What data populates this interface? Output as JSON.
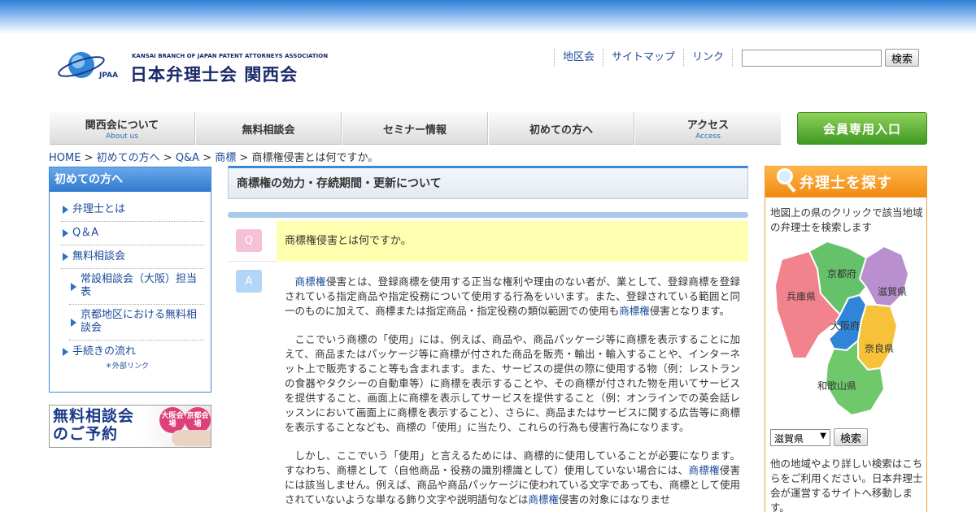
{
  "header": {
    "logo_sub": "KANSAI BRANCH OF JAPAN PATENT ATTORNEYS ASSOCIATION",
    "logo_mark": "JPAA",
    "logo_name": "日本弁理士会 関西会",
    "links": [
      "地区会",
      "サイトマップ",
      "リンク"
    ],
    "search_button": "検索",
    "search_value": ""
  },
  "gnav": [
    {
      "label": "関西会について",
      "sub": "About us"
    },
    {
      "label": "無料相談会",
      "sub": ""
    },
    {
      "label": "セミナー情報",
      "sub": ""
    },
    {
      "label": "初めての方へ",
      "sub": ""
    },
    {
      "label": "アクセス",
      "sub": "Access"
    }
  ],
  "member_button": "会員専用入口",
  "breadcrumb": {
    "items": [
      "HOME",
      "初めての方へ",
      "Q&A",
      "商標"
    ],
    "separator": " > ",
    "current": "商標権侵害とは何ですか。"
  },
  "sidenav": {
    "title": "初めての方へ",
    "items": [
      {
        "label": "弁理士とは"
      },
      {
        "label": "Q＆A"
      },
      {
        "label": "無料相談会"
      },
      {
        "label": "常設相談会（大阪）担当表"
      },
      {
        "label": "京都地区における無料相談会"
      },
      {
        "label": "手続きの流れ",
        "note": "＊外部リンク"
      }
    ]
  },
  "banner": {
    "line1": "無料相談会",
    "line2": "のご予約",
    "badge1": "大阪会場",
    "badge2": "京都会場"
  },
  "main": {
    "section_title": "商標権の効力・存続期間・更新について",
    "q_label": "Q",
    "question": "商標権侵害とは何ですか。",
    "a_label": "A",
    "p1_link1": "商標権",
    "p1_text1": "侵害とは、登録商標を使用する正当な権利や理由のない者が、業として、登録商標を登録されている指定商品や指定役務について使用する行為をいいます。また、登録されている範囲と同一のものに加えて、商標または指定商品・指定役務の類似範囲での使用も",
    "p1_link2": "商標権",
    "p1_text2": "侵害となります。",
    "p2": "ここでいう商標の「使用」には、例えば、商品や、商品パッケージ等に商標を表示することに加えて、商品またはパッケージ等に商標が付された商品を販売・輸出・輸入することや、インターネット上で販売すること等も含まれます。また、サービスの提供の際に使用する物（例：レストランの食器やタクシーの自動車等）に商標を表示することや、その商標が付された物を用いてサービスを提供すること、画面上に商標を表示してサービスを提供すること（例：オンラインでの英会話レッスンにおいて画面上に商標を表示すること）、さらに、商品またはサービスに関する広告等に商標を表示することなども、商標の「使用」に当たり、これらの行為も侵害行為になります。",
    "p3_text1": "しかし、ここでいう「使用」と言えるためには、商標的に使用していることが必要になります。すなわち、商標として（自他商品・役務の識別標識として）使用していない場合には、",
    "p3_link1": "商標権",
    "p3_text2": "侵害には該当しません。例えば、商品や商品パッケージに使われている文字であっても、商標として使用されていないような単なる飾り文字や説明語句などは",
    "p3_link2": "商標権",
    "p3_text3": "侵害の対象にはなりませ"
  },
  "finder": {
    "title": "弁理士を探す",
    "desc": "地図上の県のクリックで該当地域の弁理士を検索します",
    "prefectures": [
      {
        "name": "京都府",
        "color": "#66c26a"
      },
      {
        "name": "滋賀県",
        "color": "#b98fd0"
      },
      {
        "name": "兵庫県",
        "color": "#f2828c"
      },
      {
        "name": "大阪府",
        "color": "#2f86d8"
      },
      {
        "name": "奈良県",
        "color": "#f5c23a"
      },
      {
        "name": "和歌山県",
        "color": "#6fc86a"
      }
    ],
    "select_value": "滋賀県",
    "search_button": "検索",
    "note": "他の地域やより詳しい検索はこちらをご利用ください。日本弁理士会が運営するサイトへ移動します。"
  }
}
